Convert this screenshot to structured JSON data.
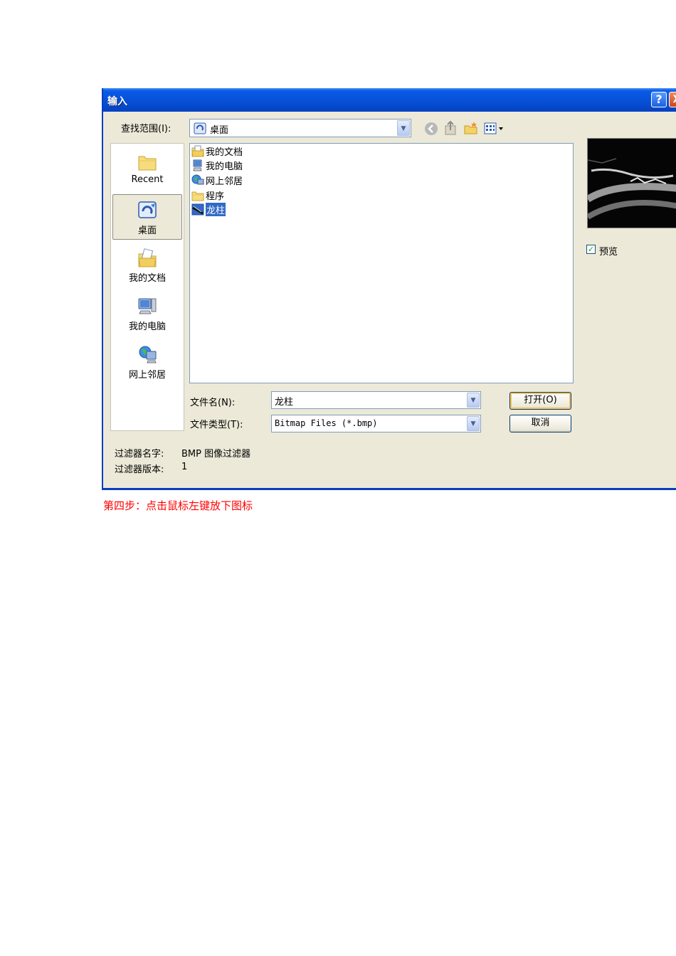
{
  "dialog": {
    "title": "输入",
    "help_label": "?",
    "close_label": "X"
  },
  "lookin": {
    "label": "查找范围(I):",
    "value": "桌面"
  },
  "places": [
    {
      "label": "Recent",
      "icon": "folder-icon"
    },
    {
      "label": "桌面",
      "icon": "desktop-icon"
    },
    {
      "label": "我的文档",
      "icon": "documents-icon"
    },
    {
      "label": "我的电脑",
      "icon": "computer-icon"
    },
    {
      "label": "网上邻居",
      "icon": "network-icon"
    }
  ],
  "files": [
    {
      "name": "我的文档",
      "icon": "documents-icon"
    },
    {
      "name": "我的电脑",
      "icon": "computer-icon"
    },
    {
      "name": "网上邻居",
      "icon": "network-icon"
    },
    {
      "name": "程序",
      "icon": "folder-icon"
    },
    {
      "name": "龙柱",
      "icon": "image-file-icon",
      "selected": true
    }
  ],
  "filename": {
    "label": "文件名(N):",
    "value": "龙柱"
  },
  "filetype": {
    "label": "文件类型(T):",
    "value": "Bitmap Files (*.bmp)"
  },
  "buttons": {
    "open": "打开(O)",
    "cancel": "取消"
  },
  "preview": {
    "label": "预览",
    "checked": true
  },
  "filter": {
    "name_label": "过滤器名字:",
    "name_value": "BMP 图像过滤器",
    "version_label": "过滤器版本:",
    "version_value": "1"
  },
  "caption": "第四步：点击鼠标左键放下图标",
  "colors": {
    "titlebar": "#0650d6",
    "dialog_bg": "#ece9d8",
    "selection": "#316ac5",
    "caption": "#ff0000"
  }
}
